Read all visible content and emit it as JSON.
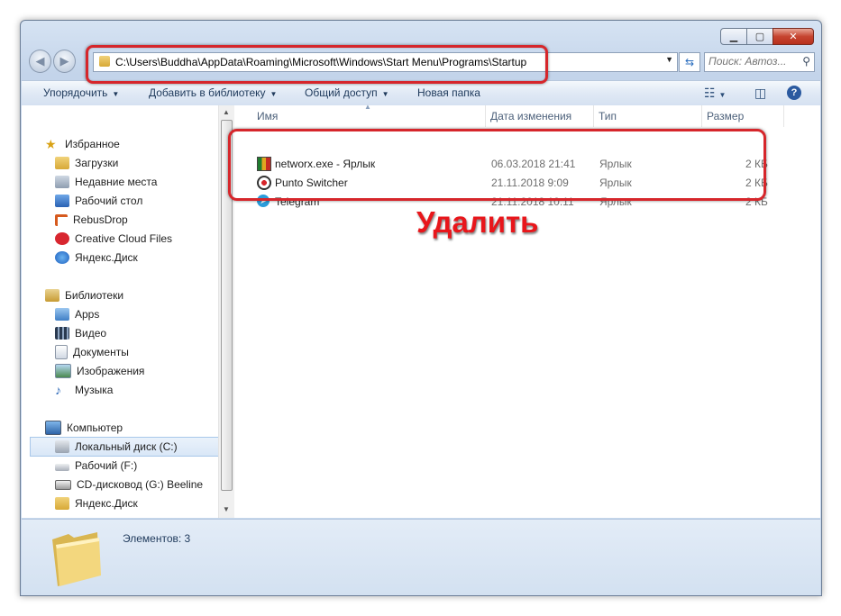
{
  "window": {
    "caption_buttons": {
      "minimize": "▁",
      "maximize": "▢",
      "close": "✕"
    },
    "address": "C:\\Users\\Buddha\\AppData\\Roaming\\Microsoft\\Windows\\Start Menu\\Programs\\Startup",
    "search_placeholder": "Поиск: Автоз..."
  },
  "toolbar": {
    "organize": "Упорядочить",
    "add_to_library": "Добавить в библиотеку",
    "share": "Общий доступ",
    "new_folder": "Новая папка"
  },
  "nav": {
    "favorites": {
      "title": "Избранное",
      "items": [
        "Загрузки",
        "Недавние места",
        "Рабочий стол",
        "RebusDrop",
        "Creative Cloud Files",
        "Яндекс.Диск"
      ]
    },
    "libraries": {
      "title": "Библиотеки",
      "items": [
        "Apps",
        "Видео",
        "Документы",
        "Изображения",
        "Музыка"
      ]
    },
    "computer": {
      "title": "Компьютер",
      "items": [
        "Локальный диск (C:)",
        "Рабочий (F:)",
        "CD-дисковод (G:) Beeline",
        "Яндекс.Диск"
      ]
    }
  },
  "columns": [
    "Имя",
    "Дата изменения",
    "Тип",
    "Размер"
  ],
  "files": [
    {
      "name": "networx.exe - Ярлык",
      "date": "06.03.2018 21:41",
      "type": "Ярлык",
      "size": "2 КБ"
    },
    {
      "name": "Punto Switcher",
      "date": "21.11.2018 9:09",
      "type": "Ярлык",
      "size": "2 КБ"
    },
    {
      "name": "Telegram",
      "date": "21.11.2018 10:11",
      "type": "Ярлык",
      "size": "2 КБ"
    }
  ],
  "annotation": "Удалить",
  "status": "Элементов: 3",
  "colors": {
    "annotation_red": "#e8161b",
    "highlight_red": "#d6262b"
  }
}
